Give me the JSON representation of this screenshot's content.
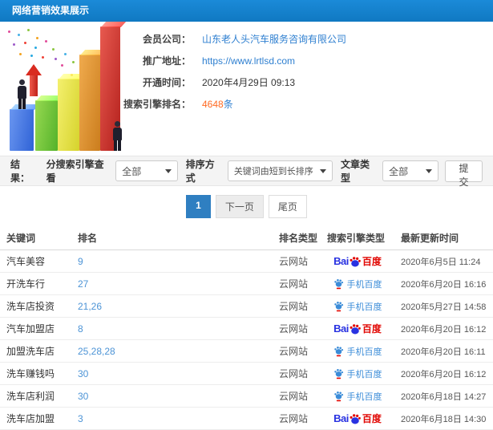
{
  "header": {
    "title": "网络营销效果展示"
  },
  "colors": {
    "topbar_blue": "#1581cd",
    "link_blue": "#2e7fd0",
    "rank_blue": "#4d94d6",
    "highlight_orange": "#ff6a22",
    "baidu_blue": "#2932e1",
    "baidu_red": "#e10602",
    "pagination_active": "#2f7fc1"
  },
  "member_info": {
    "company_label": "会员公司：",
    "company_value": "山东老人头汽车服务咨询有限公司",
    "url_label": "推广地址：",
    "url_value": "https://www.lrtlsd.com",
    "open_time_label": "开通时间：",
    "open_time_value": "2020年4月29日 09:13",
    "rank_label": "搜索引擎排名：",
    "rank_count": "4648",
    "rank_unit": "条"
  },
  "filter_bar": {
    "result_label": "结果：",
    "engine_label": "分搜索引擎查看",
    "engine_value": "全部",
    "sort_label": "排序方式",
    "sort_value": "关键词由短到长排序",
    "article_label": "文章类型",
    "article_value": "全部",
    "submit_label": "提交"
  },
  "pagination": {
    "current": "1",
    "next_label": "下一页",
    "last_label": "尾页"
  },
  "table": {
    "headers": [
      "关键词",
      "排名",
      "排名类型",
      "搜索引擎类型",
      "最新更新时间"
    ],
    "logos": {
      "baidu_text": "Bai",
      "baidu_cn": "百度",
      "mobile_baidu": "手机百度"
    },
    "rows": [
      {
        "keyword": "汽车美容",
        "rank": "9",
        "rank_type": "云网站",
        "engine": "baidu",
        "updated": "2020年6月5日 11:24"
      },
      {
        "keyword": "开洗车行",
        "rank": "27",
        "rank_type": "云网站",
        "engine": "mobile-baidu",
        "updated": "2020年6月20日 16:16"
      },
      {
        "keyword": "洗车店投资",
        "rank": "21,26",
        "rank_type": "云网站",
        "engine": "mobile-baidu",
        "updated": "2020年5月27日 14:58"
      },
      {
        "keyword": "汽车加盟店",
        "rank": "8",
        "rank_type": "云网站",
        "engine": "baidu",
        "updated": "2020年6月20日 16:12"
      },
      {
        "keyword": "加盟洗车店",
        "rank": "25,28,28",
        "rank_type": "云网站",
        "engine": "mobile-baidu",
        "updated": "2020年6月20日 16:11"
      },
      {
        "keyword": "洗车赚钱吗",
        "rank": "30",
        "rank_type": "云网站",
        "engine": "mobile-baidu",
        "updated": "2020年6月20日 16:12"
      },
      {
        "keyword": "洗车店利润",
        "rank": "30",
        "rank_type": "云网站",
        "engine": "mobile-baidu",
        "updated": "2020年6月18日 14:27"
      },
      {
        "keyword": "洗车店加盟",
        "rank": "3",
        "rank_type": "云网站",
        "engine": "baidu",
        "updated": "2020年6月18日 14:30"
      }
    ]
  }
}
